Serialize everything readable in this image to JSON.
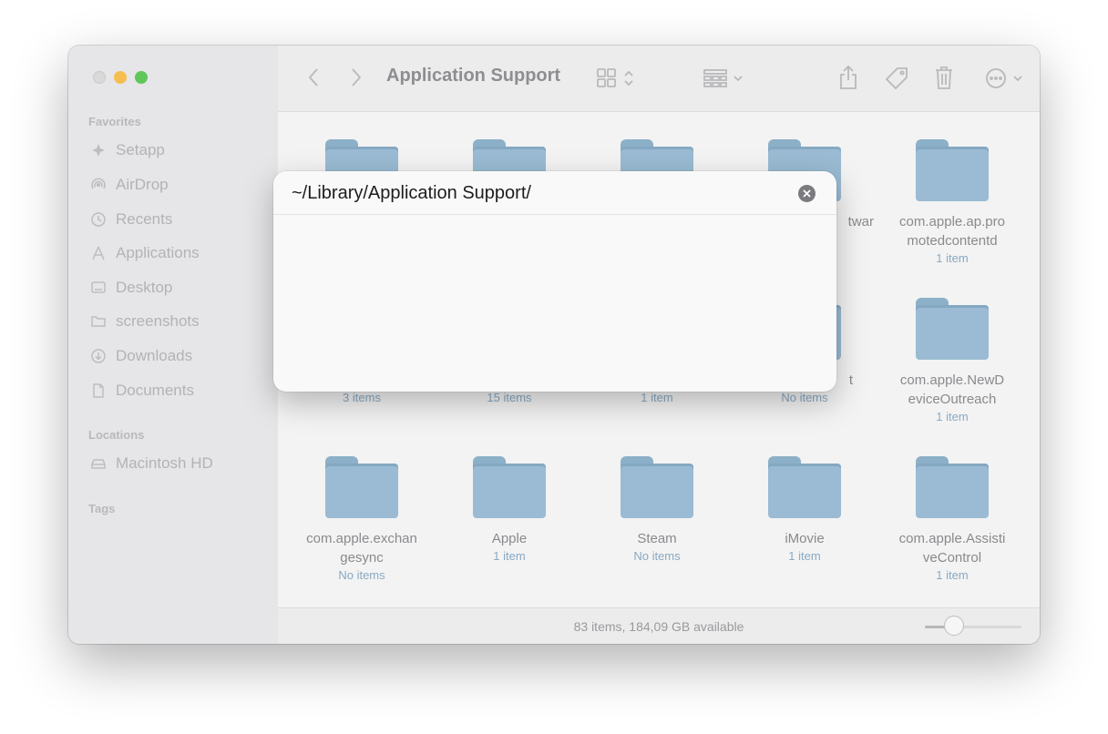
{
  "window": {
    "title": "Application Support"
  },
  "sidebar": {
    "favorites_title": "Favorites",
    "favorites": [
      {
        "label": "Setapp",
        "icon": "setapp-icon"
      },
      {
        "label": "AirDrop",
        "icon": "airdrop-icon"
      },
      {
        "label": "Recents",
        "icon": "clock-icon"
      },
      {
        "label": "Applications",
        "icon": "applications-icon"
      },
      {
        "label": "Desktop",
        "icon": "desktop-icon"
      },
      {
        "label": "screenshots",
        "icon": "folder-icon"
      },
      {
        "label": "Downloads",
        "icon": "download-icon"
      },
      {
        "label": "Documents",
        "icon": "document-icon"
      }
    ],
    "locations_title": "Locations",
    "locations": [
      {
        "label": "Macintosh HD",
        "icon": "drive-icon"
      }
    ],
    "tags_title": "Tags"
  },
  "toolbar": {
    "icons": [
      "back-icon",
      "forward-icon",
      "grid-view-icon",
      "group-icon",
      "share-icon",
      "tag-icon",
      "trash-icon",
      "more-icon",
      "search-icon"
    ]
  },
  "items": [
    {
      "name": "",
      "count": ""
    },
    {
      "name": "",
      "count": ""
    },
    {
      "name": "",
      "count": ""
    },
    {
      "name": "twar",
      "count": ""
    },
    {
      "name": "com.apple.ap.pro\nmotedcontentd",
      "count": "1 item"
    },
    {
      "name": "",
      "count": "3 items"
    },
    {
      "name": "",
      "count": "15 items"
    },
    {
      "name": "",
      "count": "1 item"
    },
    {
      "name": "t",
      "count": "No items"
    },
    {
      "name": "com.apple.NewD\neviceOutreach",
      "count": "1 item"
    },
    {
      "name": "com.apple.exchan\ngesync",
      "count": "No items"
    },
    {
      "name": "Apple",
      "count": "1 item"
    },
    {
      "name": "Steam",
      "count": "No items"
    },
    {
      "name": "iMovie",
      "count": "1 item"
    },
    {
      "name": "com.apple.Assisti\nveControl",
      "count": "1 item"
    }
  ],
  "status": {
    "text": "83 items, 184,09 GB available",
    "zoom_level": 0.3
  },
  "go_dialog": {
    "path": "~/Library/Application Support/"
  },
  "colors": {
    "folder": "#9abbd3",
    "accent_close": "#d9d9d9",
    "accent_min": "#f6be4f",
    "accent_max": "#5fc75a"
  }
}
